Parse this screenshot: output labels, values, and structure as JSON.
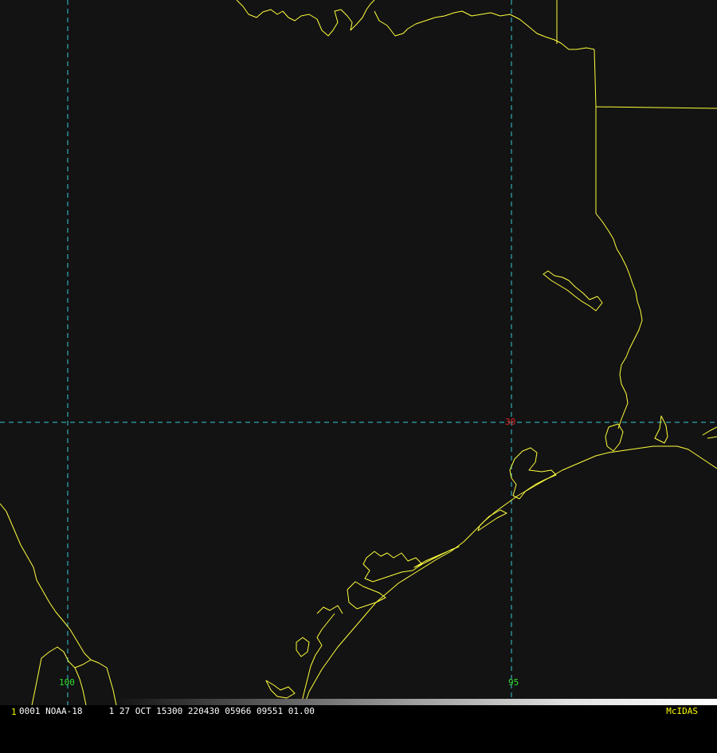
{
  "map": {
    "lat_lines": [
      {
        "label": "30"
      }
    ],
    "lon_lines": [
      {
        "label": "100"
      },
      {
        "label": "95"
      }
    ],
    "colors": {
      "coastline": "#ffff3c",
      "grid": "#38c8d8",
      "lat_label": "#e02020",
      "lon_label": "#30e030",
      "background": "#131313"
    }
  },
  "status_bar": {
    "frame_number": "1",
    "text": "0001 NOAA-18     1 27 OCT 15300 220430 05966 09551 01.00",
    "brand": "McIDAS",
    "colors": {
      "frame_number": "#ffff00",
      "text": "#ffffff",
      "brand": "#ffff00"
    }
  }
}
